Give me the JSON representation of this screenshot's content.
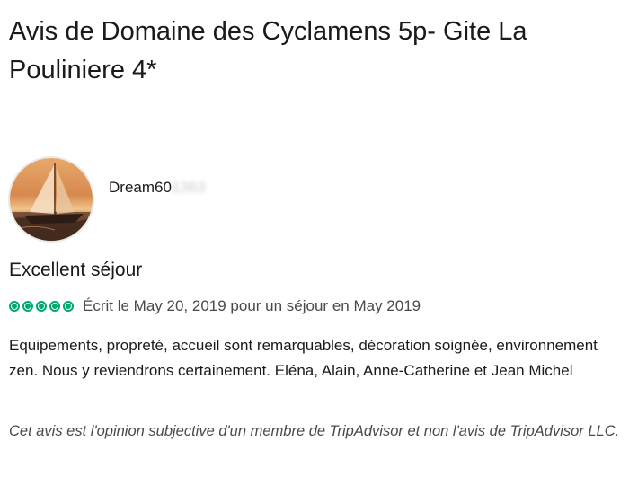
{
  "page": {
    "title": "Avis de Domaine des Cyclamens 5p- Gite La Pouliniere 4*"
  },
  "review": {
    "author_visible": "Dream60",
    "author_masked": "1363",
    "title": "Excellent séjour",
    "rating": 5,
    "rating_max": 5,
    "bubble_color": "#00aa6c",
    "date_text": "Écrit le May 20, 2019 pour un séjour en May 2019",
    "body": "Equipements, propreté, accueil sont remarquables, décoration soignée, environnement zen. Nous y reviendrons certainement. Eléna, Alain, Anne-Catherine et Jean Michel",
    "disclaimer": "Cet avis est l'opinion subjective d'un membre de TripAdvisor et non l'avis de TripAdvisor LLC."
  },
  "icons": {
    "avatar": "sailboat-photo-avatar",
    "rating": "rating-bubble-icon"
  }
}
